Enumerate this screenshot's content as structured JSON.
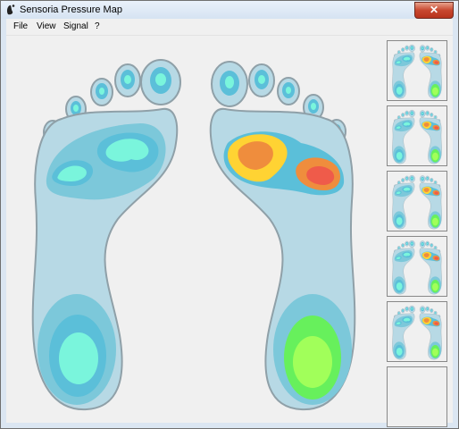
{
  "window": {
    "title": "Sensoria Pressure Map",
    "close_label": "✕"
  },
  "menu": {
    "items": [
      "File",
      "View",
      "Signal",
      "?"
    ]
  },
  "colors": {
    "foot_outline": "#8fa0a8",
    "foot_base": "#b7d9e5",
    "pressure_low": "#7cc8da",
    "pressure_mid": "#5bbfd9",
    "pressure_cool_peak": "#7af5dc",
    "pressure_warm": "#ffd333",
    "pressure_hot": "#ef8d3d",
    "pressure_max": "#ef5b4a",
    "heel_green_mid": "#67f05c",
    "heel_green_peak": "#a1ff5a"
  },
  "history_panel": {
    "thumbnail_count": 5,
    "empty_slots": 1
  }
}
